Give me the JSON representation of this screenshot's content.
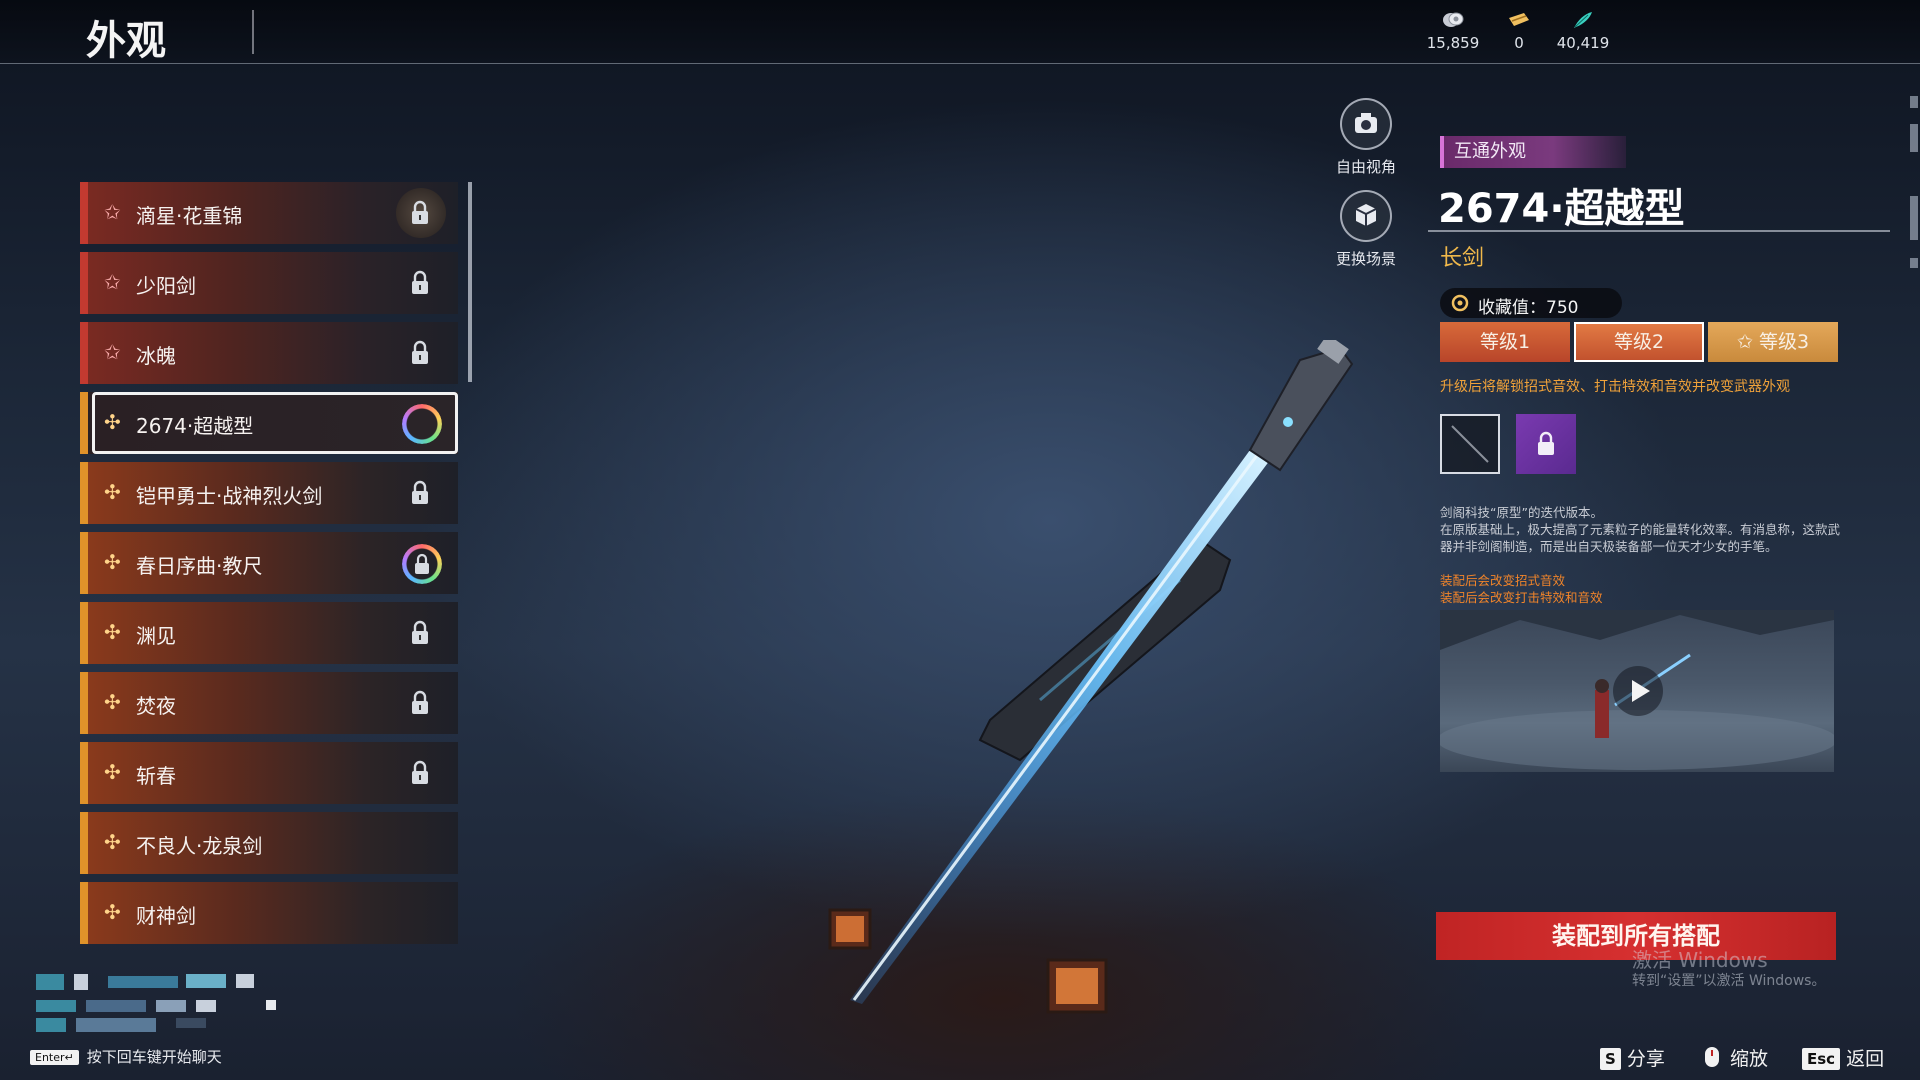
{
  "header": {
    "title": "外观",
    "currencies": [
      {
        "icon": "coin-icon",
        "value": "15,859"
      },
      {
        "icon": "ticket-icon",
        "value": "0"
      },
      {
        "icon": "feather-icon",
        "value": "40,419"
      }
    ]
  },
  "skin_list": {
    "items": [
      {
        "name": "滴星·花重锦",
        "tier": "red",
        "status": "locked-emblem"
      },
      {
        "name": "少阳剑",
        "tier": "red",
        "status": "locked"
      },
      {
        "name": "冰魄",
        "tier": "red",
        "status": "locked"
      },
      {
        "name": "2674·超越型",
        "tier": "gold",
        "status": "ring",
        "selected": true
      },
      {
        "name": "铠甲勇士·战神烈火剑",
        "tier": "gold",
        "status": "locked"
      },
      {
        "name": "春日序曲·教尺",
        "tier": "gold",
        "status": "ring-locked"
      },
      {
        "name": "渊见",
        "tier": "gold",
        "status": "locked"
      },
      {
        "name": "焚夜",
        "tier": "gold",
        "status": "locked"
      },
      {
        "name": "斩春",
        "tier": "gold",
        "status": "locked"
      },
      {
        "name": "不良人·龙泉剑",
        "tier": "gold",
        "status": "none"
      },
      {
        "name": "财神剑",
        "tier": "gold",
        "status": "none"
      }
    ]
  },
  "camera": {
    "free_view": "自由视角",
    "change_scene": "更换场景"
  },
  "detail": {
    "tag": "互通外观",
    "title": "2674·超越型",
    "type": "长剑",
    "collection_label": "收藏值：750",
    "levels": [
      "等级1",
      "等级2",
      "等级3"
    ],
    "selected_level": "等级2",
    "upgrade_hint": "升级后将解锁招式音效、打击特效和音效并改变武器外观",
    "description": [
      "剑阁科技“原型”的迭代版本。",
      "在原版基础上，极大提高了元素粒子的能量转化效率。有消息称，这款武器并非剑阁制造，而是出自天极装备部一位天才少女的手笔。"
    ],
    "effect_notes": [
      "装配后会改变招式音效",
      "装配后会改变打击特效和音效"
    ],
    "equip_all_button": "装配到所有搭配"
  },
  "watermark": {
    "line1": "激活 Windows",
    "line2": "转到“设置”以激活 Windows。"
  },
  "chat": {
    "key": "Enter↵",
    "hint": "按下回车键开始聊天"
  },
  "footer_hints": [
    {
      "key": "S",
      "label": "分享"
    },
    {
      "key": "",
      "label": "缩放"
    },
    {
      "key": "Esc",
      "label": "返回"
    }
  ],
  "colors": {
    "accent_red": "#c23a30",
    "accent_gold": "#e0922a",
    "equip_button": "#d63030",
    "tag_purple": "#7a3a7e"
  }
}
